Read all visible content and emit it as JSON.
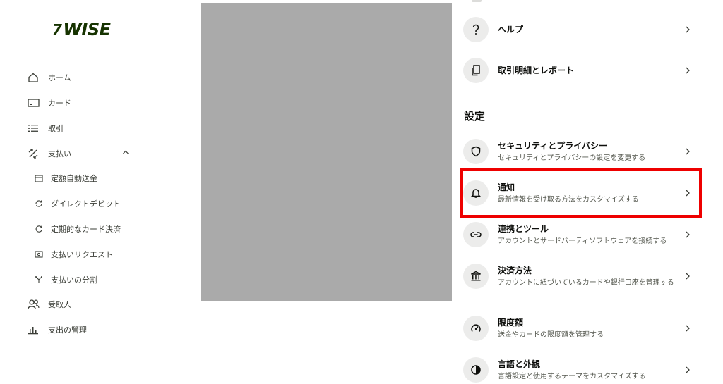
{
  "brand": {
    "logo_text": "WISE",
    "logo_mark": "7",
    "color": "#163300"
  },
  "sidebar": {
    "items": [
      {
        "label": "ホーム",
        "icon": "home-icon"
      },
      {
        "label": "カード",
        "icon": "card-icon"
      },
      {
        "label": "取引",
        "icon": "list-icon"
      },
      {
        "label": "支払い",
        "icon": "payments-icon",
        "expanded": true
      },
      {
        "label": "受取人",
        "icon": "recipients-icon"
      },
      {
        "label": "支出の管理",
        "icon": "bar-chart-icon"
      }
    ],
    "payment_subitems": [
      {
        "label": "定額自動送金",
        "icon": "calendar-icon"
      },
      {
        "label": "ダイレクトデビット",
        "icon": "refresh-icon"
      },
      {
        "label": "定期的なカード決済",
        "icon": "repeat-icon"
      },
      {
        "label": "支払いリクエスト",
        "icon": "request-icon"
      },
      {
        "label": "支払いの分割",
        "icon": "split-icon"
      }
    ]
  },
  "account": {
    "items_top": [
      {
        "title": "ヘルプ",
        "icon": "question-icon"
      },
      {
        "title": "取引明細とレポート",
        "icon": "documents-icon"
      }
    ],
    "settings_heading": "設定",
    "settings": [
      {
        "title": "セキュリティとプライバシー",
        "subtitle": "セキュリティとプライバシーの設定を変更する",
        "icon": "shield-icon"
      },
      {
        "title": "通知",
        "subtitle": "最新情報を受け取る方法をカスタマイズする",
        "icon": "bell-icon",
        "highlighted": true
      },
      {
        "title": "連携とツール",
        "subtitle": "アカウントとサードパーティソフトウェアを接続する",
        "icon": "link-icon"
      },
      {
        "title": "決済方法",
        "subtitle": "アカウントに紐づいているカードや銀行口座を管理する",
        "icon": "bank-icon"
      },
      {
        "title": "限度額",
        "subtitle": "送金やカードの限度額を管理する",
        "icon": "gauge-icon"
      },
      {
        "title": "言語と外観",
        "subtitle": "言語設定と使用するテーマをカスタマイズする",
        "icon": "contrast-icon"
      }
    ]
  },
  "colors": {
    "highlight": "#ee0000",
    "icon_bg": "#ececeb",
    "placeholder": "#aaaaaa"
  }
}
